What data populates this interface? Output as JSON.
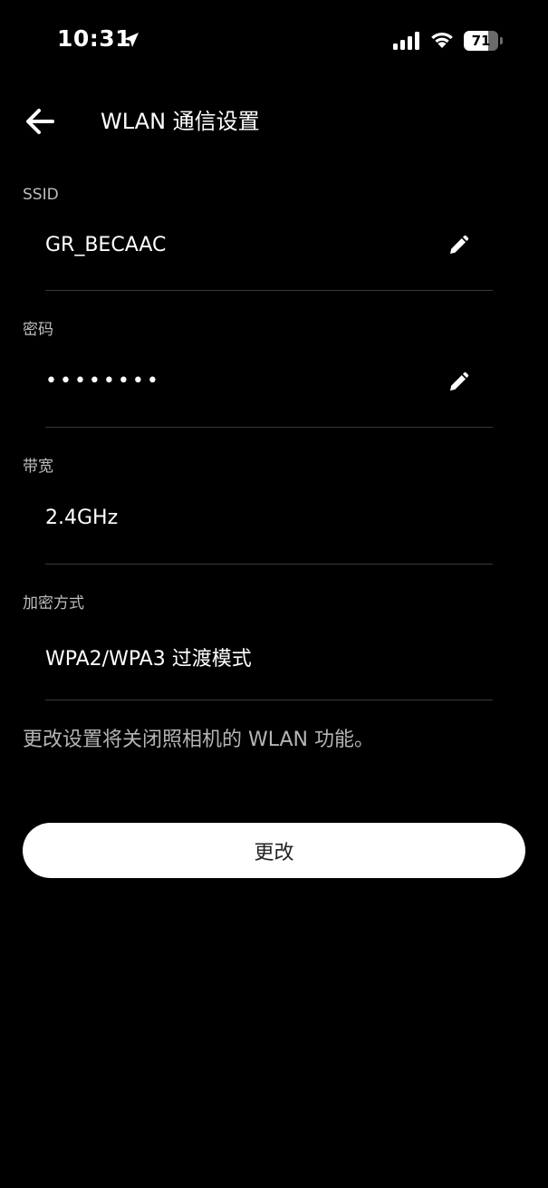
{
  "status_bar": {
    "time": "10:31",
    "battery_level": "71",
    "battery_fraction": 0.71
  },
  "header": {
    "title": "WLAN 通信设置",
    "back_icon": "arrow-left-icon"
  },
  "fields": {
    "ssid": {
      "label": "SSID",
      "value": "GR_BECAAC",
      "edit_icon": "pencil-icon"
    },
    "password": {
      "label": "密码",
      "value": "••••••••",
      "edit_icon": "pencil-icon"
    },
    "bandwidth": {
      "label": "带宽",
      "value": "2.4GHz"
    },
    "encryption": {
      "label": "加密方式",
      "value": "WPA2/WPA3 过渡模式"
    }
  },
  "notice": "更改设置将关闭照相机的 WLAN 功能。",
  "actions": {
    "change_label": "更改"
  },
  "colors": {
    "background": "#000000",
    "divider": "#3a3a3a",
    "button_bg": "#ffffff"
  }
}
